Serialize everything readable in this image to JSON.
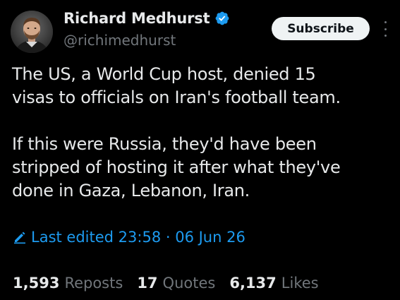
{
  "author": {
    "display_name": "Richard Medhurst",
    "handle": "@richimedhurst",
    "verified": true
  },
  "header": {
    "subscribe_label": "Subscribe"
  },
  "tweet": {
    "paragraph_1": "The US, a World Cup host, denied 15\nvisas to officials on Iran's football team.",
    "paragraph_2": "If this were Russia, they'd have been\nstripped of hosting it after what they've\ndone in Gaza, Lebanon, Iran.",
    "edited_label": "Last edited 23:58 · 06 Jun 26"
  },
  "stats": [
    {
      "count": "1,593",
      "label": "Reposts"
    },
    {
      "count": "17",
      "label": "Quotes"
    },
    {
      "count": "6,137",
      "label": "Likes"
    }
  ],
  "colors": {
    "background": "#000000",
    "primary_text": "#e7e9ea",
    "secondary_text": "#71767b",
    "accent_blue": "#1d9bf0",
    "subscribe_bg": "#eff3f4"
  },
  "icons": {
    "verified": "verified-badge-icon",
    "edited": "pencil-icon",
    "more": "more-vertical-icon"
  }
}
